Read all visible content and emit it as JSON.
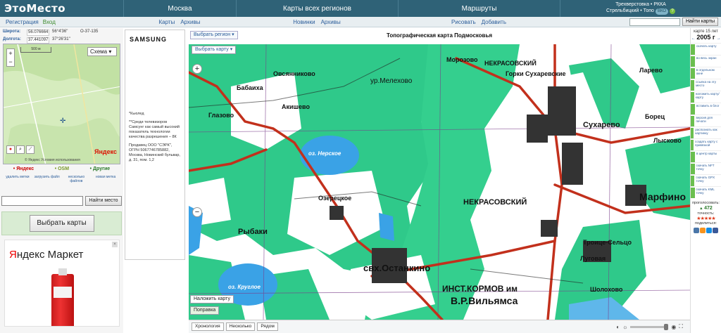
{
  "header": {
    "logo": "ЭтоМесто",
    "nav": [
      "Москва",
      "Карты всех регионов",
      "Маршруты"
    ],
    "right_line1": "Трехверстовка • РККА",
    "right_line2": "Стрельбицкий • Топо",
    "badge": "ВКО",
    "help": "?"
  },
  "subnav": {
    "register": "Регистрация",
    "login": "Вход",
    "moscow_links": [
      "Карты",
      "Архивы"
    ],
    "regions_links": [
      "Новинки",
      "Архивы"
    ],
    "routes_links": [
      "Рисовать",
      "Добавить"
    ],
    "search_button": "Найти карты"
  },
  "left": {
    "lat_label": "Широта:",
    "lat_value": "56.076664",
    "lat_dms": "56°4'36\"",
    "lat_extra": "O-37-135",
    "lon_label": "Долгота:",
    "lon_value": "37.441097",
    "lon_dms": "37°26'31\"",
    "minimap": {
      "zoom_plus": "+",
      "zoom_minus": "−",
      "scale": "500 м",
      "schema": "Схема",
      "provider_logo": "Яндекс",
      "copyright": "© Яндекс  Условия использования"
    },
    "providers": [
      "• Яндекс",
      "• OSM",
      "• Другие"
    ],
    "actions": [
      "удалить метки",
      "загрузить файл",
      "несколько файлов",
      "новая метка"
    ],
    "search_button": "Найти место",
    "choose_button": "Выбрать карты",
    "ad": {
      "title_part1": "Я",
      "title_part2": "ндекс Маркет",
      "close": "×"
    }
  },
  "mid_ad": {
    "brand": "SAMSUNG",
    "para1": "*Кьюлед",
    "para2": "**Среди телевизоров Самсунг как самый высокий показатель технологии качества разрешения – 8К",
    "para3": "Продавец ООО \"СЭРК\", ОГРН 5067746785882, Москва, Новинский бульвар, д. 31, пом. 1,2"
  },
  "map": {
    "region_button": "Выбрать регион ▾",
    "title": "Топографическая карта Подмосковья",
    "card_button": "Выбрать карту ▾",
    "zoom_plus": "+",
    "zoom_minus": "−",
    "overlay_button": "Наложить карту",
    "fix_button": "Поправка",
    "labels": [
      "Овсянниково",
      "Бабаиха",
      "Акишево",
      "Глазово",
      "ур.Мелехово",
      "Морозово",
      "НЕКРАСОВСКИЙ",
      "Горки",
      "Сухаревские",
      "оз. Нерское",
      "Озерецкое",
      "НЕКРАСОВСКИЙ",
      "Сухарево",
      "Марфино",
      "Рыбаки",
      "свх.Останкино",
      "оз. Круглое",
      "ИНСТ.КОРМОВ им",
      "В.Р.Вильямса",
      "Троице-Сельцо",
      "Луговая",
      "Шолохово",
      "Ларево",
      "Лысково",
      "Борец"
    ]
  },
  "footer": {
    "buttons": [
      "Хронология",
      "Несколько",
      "Рядом"
    ]
  },
  "right": {
    "caption": "карте 15 лет",
    "prev": "←",
    "year": "2005 г",
    "next": "→",
    "tools": [
      "скачать карту",
      "во весь экран",
      "в отдельном окне",
      "ссылка на эту место",
      "наложить карту/карту",
      "вставить в блог",
      "версия для печати",
      "распознать как картинку",
      "создать карту с привязкой",
      "в центр карты",
      "скачать NFT точку",
      "скачать GPX точку",
      "скачать KML точку"
    ],
    "votes_label": "проголосовать:",
    "votes_count": "472",
    "accuracy_label": "точность:",
    "stars": "★★★★★",
    "share_label": "поделиться:"
  },
  "colors": {
    "header": "#2f6277",
    "forest": "#2fc98a",
    "water": "#3aa2e6",
    "road": "#c2301c",
    "grid": "#7a3d8a"
  }
}
